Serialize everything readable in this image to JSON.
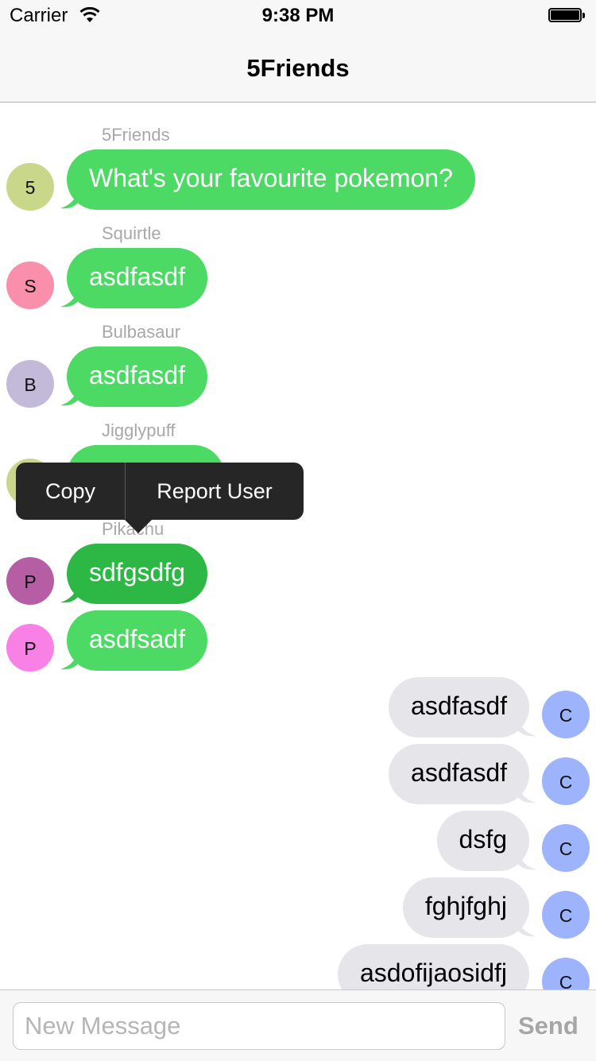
{
  "status_bar": {
    "carrier": "Carrier",
    "time": "9:38 PM"
  },
  "nav": {
    "title": "5Friends"
  },
  "messages": [
    {
      "sender": "5Friends",
      "avatar_initial": "5",
      "avatar_color": "#c9d78a",
      "text": "What's your favourite pokemon?"
    },
    {
      "sender": "Squirtle",
      "avatar_initial": "S",
      "avatar_color": "#f98fab",
      "text": "asdfasdf"
    },
    {
      "sender": "Bulbasaur",
      "avatar_initial": "B",
      "avatar_color": "#c3b9d9",
      "text": "asdfasdf"
    },
    {
      "sender": "Jigglypuff",
      "avatar_initial": "",
      "avatar_color": "#c9d78a",
      "text": ""
    },
    {
      "sender": "Pikachu",
      "avatar_initial": "P",
      "avatar_color": "#b55ea4",
      "text": "sdfgsdfg"
    },
    {
      "sender": "",
      "avatar_initial": "P",
      "avatar_color": "#f981e6",
      "text": "asdfsadf"
    },
    {
      "avatar_initial": "C",
      "avatar_color": "#9db3fb",
      "text": "asdfasdf"
    },
    {
      "avatar_initial": "C",
      "avatar_color": "#9db3fb",
      "text": "asdfasdf"
    },
    {
      "avatar_initial": "C",
      "avatar_color": "#9db3fb",
      "text": "dsfg"
    },
    {
      "avatar_initial": "C",
      "avatar_color": "#9db3fb",
      "text": "fghjfghj"
    },
    {
      "avatar_initial": "C",
      "avatar_color": "#9db3fb",
      "text": "asdofijaosidfj"
    }
  ],
  "context_menu": {
    "copy": "Copy",
    "report": "Report User"
  },
  "composer": {
    "placeholder": "New Message",
    "value": "",
    "send_label": "Send"
  },
  "colors": {
    "incoming_bubble": "#4cd964",
    "incoming_selected": "#2db845",
    "outgoing_bubble": "#e5e5ea",
    "menu_bg": "#262626"
  }
}
